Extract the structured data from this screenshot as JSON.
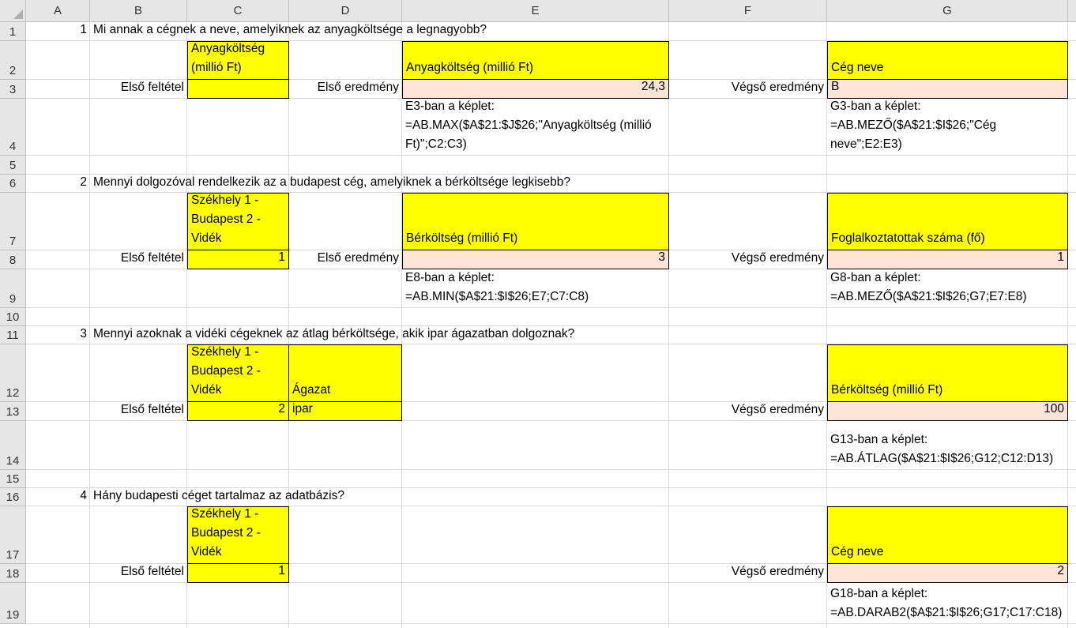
{
  "columns": [
    "A",
    "B",
    "C",
    "D",
    "E",
    "F",
    "G"
  ],
  "rows": [
    "1",
    "2",
    "3",
    "4",
    "5",
    "6",
    "7",
    "8",
    "9",
    "10",
    "11",
    "12",
    "13",
    "14",
    "15",
    "16",
    "17",
    "18",
    "19"
  ],
  "q1": {
    "num": "1",
    "question": "Mi annak a cégnek a neve, amelyiknek az anyagköltsége a legnagyobb?",
    "crit_header": "Anyagköltség\n(millió Ft)",
    "crit_value": "",
    "first_label": "Első feltétel",
    "first_result_label": "Első eredmény",
    "e_header": "Anyagköltség (millió Ft)",
    "e_value": "24,3",
    "e_formula": "E3-ban a képlet:\n=AB.MAX($A$21:$J$26;\"Anyagköltség (millió\nFt)\";C2:C3)",
    "final_label": "Végső eredmény",
    "g_header": "Cég neve",
    "g_value": "B",
    "g_formula": "G3-ban a képlet:\n=AB.MEZŐ($A$21:$I$26;\"Cég\nneve\";E2:E3)"
  },
  "q2": {
    "num": "2",
    "question": "Mennyi dolgozóval rendelkezik az a budapest cég, amelyiknek a bérköltsége legkisebb?",
    "crit_header": "Székhely 1 -\nBudapest 2 -\nVidék",
    "crit_value": "1",
    "first_label": "Első feltétel",
    "first_result_label": "Első eredmény",
    "e_header": "Bérköltség (millió Ft)",
    "e_value": "3",
    "e_formula": "E8-ban a képlet:\n=AB.MIN($A$21:$I$26;E7;C7:C8)",
    "final_label": "Végső eredmény",
    "g_header": "Foglalkoztatottak száma (fő)",
    "g_value": "1",
    "g_formula": "G8-ban a képlet:\n=AB.MEZŐ($A$21:$I$26;G7;E7:E8)"
  },
  "q3": {
    "num": "3",
    "question": "Mennyi azoknak a vidéki cégeknek az átlag bérköltsége, akik ipar ágazatban dolgoznak?",
    "crit_header": "Székhely 1 -\nBudapest 2 -\nVidék",
    "crit_value": "2",
    "crit2_header": "Ágazat",
    "crit2_value": "ipar",
    "first_label": "Első feltétel",
    "final_label": "Végső eredmény",
    "g_header": "Bérköltség (millió Ft)",
    "g_value": "100",
    "g_formula": "G13-ban a képlet:\n=AB.ÁTLAG($A$21:$I$26;G12;C12:D13)"
  },
  "q4": {
    "num": "4",
    "question": "Hány budapesti céget tartalmaz az adatbázis?",
    "crit_header": "Székhely 1 -\nBudapest 2 -\nVidék",
    "crit_value": "1",
    "first_label": "Első feltétel",
    "final_label": "Végső eredmény",
    "g_header": "Cég neve",
    "g_value": "2",
    "g_formula": "G18-ban a képlet:\n=AB.DARAB2($A$21:$I$26;G17;C17:C18)"
  },
  "colors": {
    "criteria_fill": "#ffff00",
    "result_fill": "#fce4d6",
    "header_fill": "#e6e6e6"
  }
}
